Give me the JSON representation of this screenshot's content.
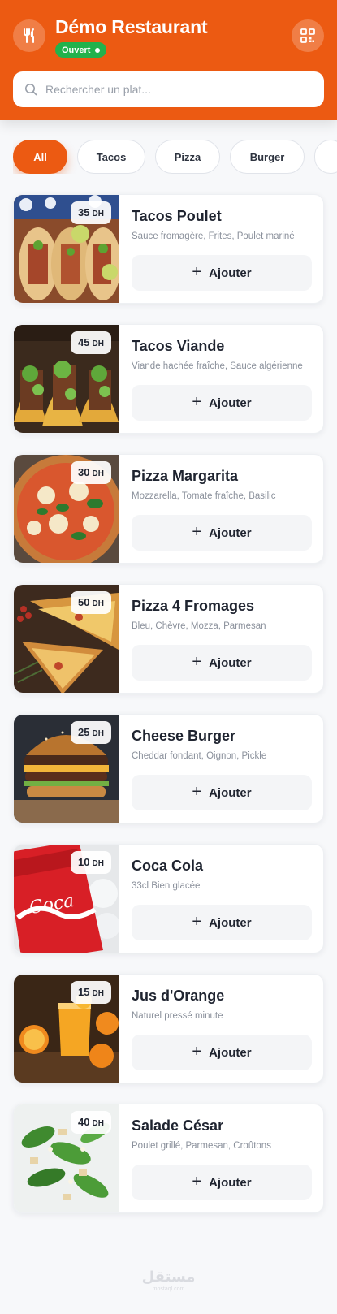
{
  "header": {
    "title": "Démo Restaurant",
    "status": "Ouvert",
    "logo_icon": "utensils-icon",
    "qr_icon": "qr-code-icon",
    "brand_color": "#ec5a12"
  },
  "search": {
    "placeholder": "Rechercher un plat...",
    "value": ""
  },
  "categories": [
    {
      "label": "All",
      "active": true
    },
    {
      "label": "Tacos",
      "active": false
    },
    {
      "label": "Pizza",
      "active": false
    },
    {
      "label": "Burger",
      "active": false
    }
  ],
  "add_label": "Ajouter",
  "products": [
    {
      "name": "Tacos Poulet",
      "description": "Sauce fromagère, Frites, Poulet mariné",
      "price": "35",
      "currency": "DH",
      "image": "tacos-chicken-photo"
    },
    {
      "name": "Tacos Viande",
      "description": "Viande hachée fraîche, Sauce algérienne",
      "price": "45",
      "currency": "DH",
      "image": "tacos-meat-photo"
    },
    {
      "name": "Pizza Margarita",
      "description": "Mozzarella, Tomate fraîche, Basilic",
      "price": "30",
      "currency": "DH",
      "image": "pizza-margarita-photo"
    },
    {
      "name": "Pizza 4 Fromages",
      "description": "Bleu, Chèvre, Mozza, Parmesan",
      "price": "50",
      "currency": "DH",
      "image": "pizza-cheese-photo"
    },
    {
      "name": "Cheese Burger",
      "description": "Cheddar fondant, Oignon, Pickle",
      "price": "25",
      "currency": "DH",
      "image": "cheese-burger-photo"
    },
    {
      "name": "Coca Cola",
      "description": "33cl Bien glacée",
      "price": "10",
      "currency": "DH",
      "image": "coca-cola-photo"
    },
    {
      "name": "Jus d'Orange",
      "description": "Naturel pressé minute",
      "price": "15",
      "currency": "DH",
      "image": "orange-juice-photo"
    },
    {
      "name": "Salade César",
      "description": "Poulet grillé, Parmesan, Croûtons",
      "price": "40",
      "currency": "DH",
      "image": "caesar-salad-photo"
    }
  ],
  "footer": {
    "logo_text": "مستقل",
    "logo_sub": "mostaql.com"
  }
}
